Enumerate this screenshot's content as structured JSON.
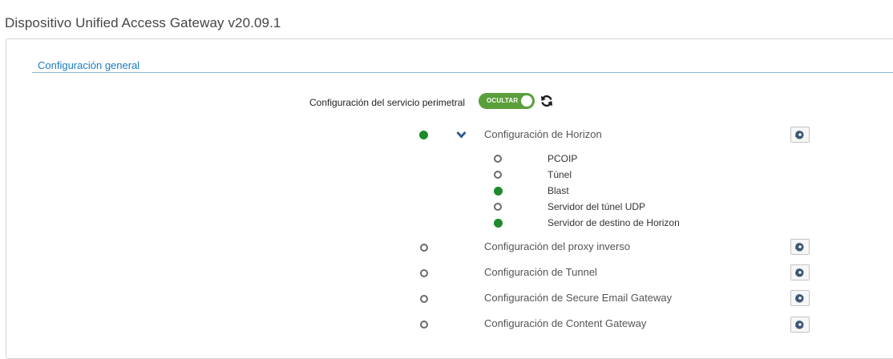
{
  "page": {
    "title": "Dispositivo Unified Access Gateway v20.09.1"
  },
  "section": {
    "title": "Configuración general"
  },
  "edge": {
    "label": "Configuración del servicio perimetral",
    "toggle_label": "OCULTAR",
    "toggle_state": "on"
  },
  "colors": {
    "enabled": "#1d8a2c",
    "toggle": "#5a9f3a",
    "link": "#1a7cc1"
  },
  "services": [
    {
      "label": "Configuración de Horizon",
      "status": "enabled",
      "expanded": true
    },
    {
      "label": "Configuración del proxy inverso",
      "status": "disabled"
    },
    {
      "label": "Configuración de Tunnel",
      "status": "disabled"
    },
    {
      "label": "Configuración de Secure Email Gateway",
      "status": "disabled"
    },
    {
      "label": "Configuración de Content Gateway",
      "status": "disabled"
    }
  ],
  "horizon_items": [
    {
      "label": "PCOIP",
      "status": "disabled"
    },
    {
      "label": "Túnel",
      "status": "disabled"
    },
    {
      "label": "Blast",
      "status": "enabled"
    },
    {
      "label": "Servidor del túnel UDP",
      "status": "disabled"
    },
    {
      "label": "Servidor de destino de Horizon",
      "status": "enabled"
    }
  ],
  "icons": {
    "refresh": "refresh-icon",
    "gear": "gear-icon",
    "expand": "chevron-down-icon"
  }
}
